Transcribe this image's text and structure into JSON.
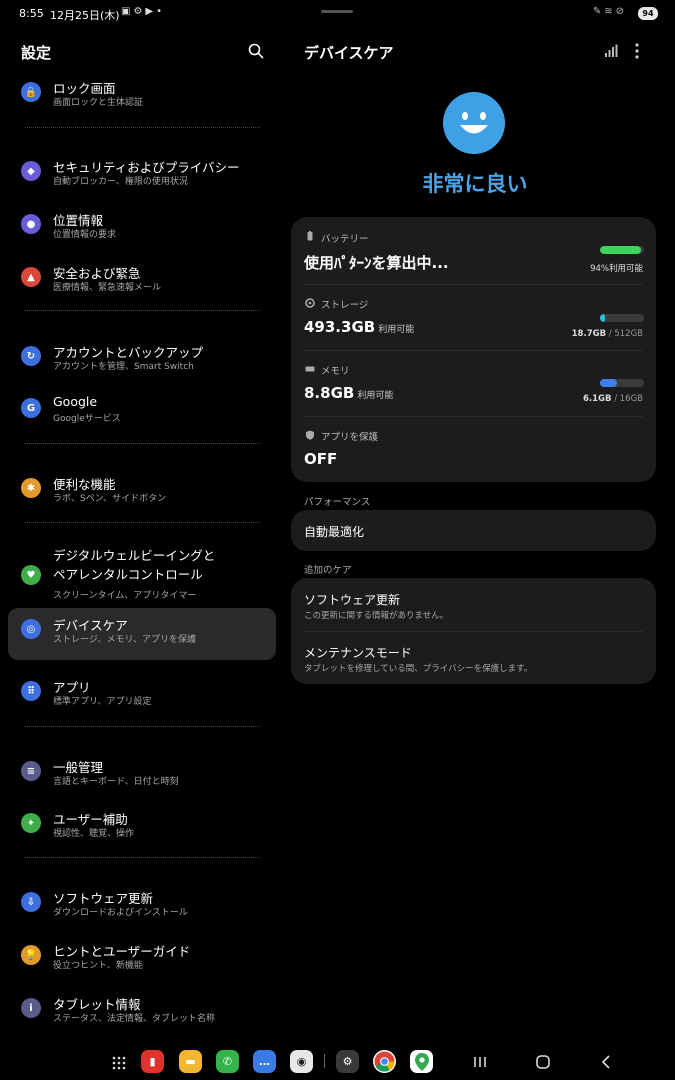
{
  "status_bar": {
    "time": "8:55",
    "date": "12月25日(木)",
    "battery": "94"
  },
  "left": {
    "title": "設定",
    "items": [
      {
        "label": "ロック画面",
        "sub": "画面ロックと生体認証",
        "color": "#3d6fe0",
        "glyph": "🔒"
      },
      {
        "label": "セキュリティおよびプライバシー",
        "sub": "自動ブロッカー、権限の使用状況",
        "color": "#6b5bd6",
        "glyph": "◆"
      },
      {
        "label": "位置情報",
        "sub": "位置情報の要求",
        "color": "#6b5bd6",
        "glyph": "●"
      },
      {
        "label": "安全および緊急",
        "sub": "医療情報、緊急速報メール",
        "color": "#d9463b",
        "glyph": "▲"
      },
      {
        "label": "アカウントとバックアップ",
        "sub": "アカウントを管理、Smart Switch",
        "color": "#3d6fe0",
        "glyph": "↻"
      },
      {
        "label": "Google",
        "sub": "Googleサービス",
        "color": "#3d6fe0",
        "glyph": "G"
      },
      {
        "label": "便利な機能",
        "sub": "ラボ、Sペン、サイドボタン",
        "color": "#e39a2d",
        "glyph": "✱"
      },
      {
        "label_line1": "デジタルウェルビーイングと",
        "label_line2": "ペアレンタルコントロール",
        "sub": "スクリーンタイム、アプリタイマー",
        "color": "#3fae4a",
        "glyph": "♥"
      },
      {
        "label": "デバイスケア",
        "sub": "ストレージ、メモリ、アプリを保護",
        "color": "#3d6fe0",
        "glyph": "◎"
      },
      {
        "label": "アプリ",
        "sub": "標準アプリ、アプリ設定",
        "color": "#3d6fe0",
        "glyph": "⠿"
      },
      {
        "label": "一般管理",
        "sub": "言語とキーボード、日付と時刻",
        "color": "#5a5c8a",
        "glyph": "≡"
      },
      {
        "label": "ユーザー補助",
        "sub": "視認性、聴覚、操作",
        "color": "#3fae4a",
        "glyph": "✦"
      },
      {
        "label": "ソフトウェア更新",
        "sub": "ダウンロードおよびインストール",
        "color": "#3d6fe0",
        "glyph": "⇩"
      },
      {
        "label": "ヒントとユーザーガイド",
        "sub": "役立つヒント、新機能",
        "color": "#e39a2d",
        "glyph": "💡"
      },
      {
        "label": "タブレット情報",
        "sub": "ステータス、法定情報、タブレット名称",
        "color": "#5a5c8a",
        "glyph": "i"
      }
    ]
  },
  "right": {
    "title": "デバイスケア",
    "status": "非常に良い",
    "battery": {
      "label": "バッテリー",
      "value": "使用ﾊﾟﾀｰﾝを算出中...",
      "caption": "94%利用可能",
      "level": 94,
      "color": "#3ed35a"
    },
    "storage": {
      "label": "ストレージ",
      "value": "493.3GB",
      "unit": "利用可能",
      "used": "18.7GB",
      "total": "/ 512GB",
      "level": 4,
      "color": "#20c4e0"
    },
    "memory": {
      "label": "メモリ",
      "value": "8.8GB",
      "unit": "利用可能",
      "used": "6.1GB",
      "total": "/ 16GB",
      "level": 38,
      "color": "#3f7fe8"
    },
    "protect": {
      "label": "アプリを保護",
      "value": "OFF"
    },
    "performance_label": "パフォーマンス",
    "auto_optimize": "自動最適化",
    "additional_label": "追加のケア",
    "software_update": {
      "title": "ソフトウェア更新",
      "sub": "この更新に関する情報がありません。"
    },
    "maintenance": {
      "title": "メンテナンスモード",
      "sub": "タブレットを修理している間、プライバシーを保護します。"
    }
  }
}
